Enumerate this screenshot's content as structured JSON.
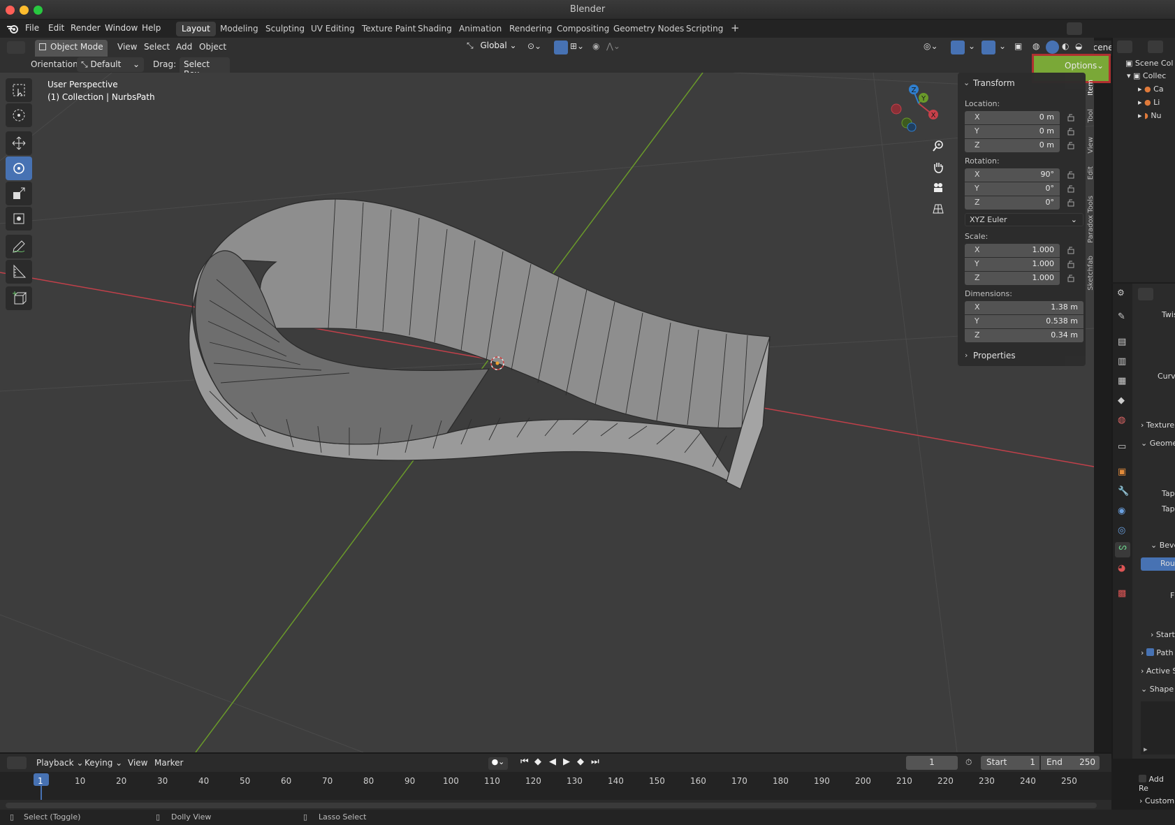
{
  "window": {
    "title": "Blender"
  },
  "menu": {
    "file": "File",
    "edit": "Edit",
    "render": "Render",
    "window": "Window",
    "help": "Help"
  },
  "workspaces": [
    "Layout",
    "Modeling",
    "Sculpting",
    "UV Editing",
    "Texture Paint",
    "Shading",
    "Animation",
    "Rendering",
    "Compositing",
    "Geometry Nodes",
    "Scripting"
  ],
  "active_workspace": "Layout",
  "add_workspace": "+",
  "scene": {
    "name": "Scene"
  },
  "header": {
    "mode": "Object Mode",
    "view": "View",
    "select": "Select",
    "add": "Add",
    "object": "Object",
    "transform_orientation": "Global",
    "orientation_label": "Orientation:",
    "orientation_value": "Default",
    "drag_label": "Drag:",
    "drag_value": "Select Box",
    "options": "Options"
  },
  "viewport": {
    "perspective": "User Perspective",
    "collection_info": "(1) Collection | NurbsPath",
    "gizmo_axes": {
      "x": "X",
      "y": "Y",
      "z": "Z"
    }
  },
  "npanel": {
    "tabs": [
      "Item",
      "Tool",
      "View",
      "Edit",
      "Paradox Tools",
      "Sketchfab"
    ],
    "transform_title": "Transform",
    "location_label": "Location:",
    "location": [
      {
        "axis": "X",
        "value": "0 m"
      },
      {
        "axis": "Y",
        "value": "0 m"
      },
      {
        "axis": "Z",
        "value": "0 m"
      }
    ],
    "rotation_label": "Rotation:",
    "rotation": [
      {
        "axis": "X",
        "value": "90°"
      },
      {
        "axis": "Y",
        "value": "0°"
      },
      {
        "axis": "Z",
        "value": "0°"
      }
    ],
    "rotation_mode": "XYZ Euler",
    "scale_label": "Scale:",
    "scale": [
      {
        "axis": "X",
        "value": "1.000"
      },
      {
        "axis": "Y",
        "value": "1.000"
      },
      {
        "axis": "Z",
        "value": "1.000"
      }
    ],
    "dimensions_label": "Dimensions:",
    "dimensions": [
      {
        "axis": "X",
        "value": "1.38 m"
      },
      {
        "axis": "Y",
        "value": "0.538 m"
      },
      {
        "axis": "Z",
        "value": "0.34 m"
      }
    ],
    "properties_title": "Properties"
  },
  "outliner": {
    "scene_collection": "Scene Col",
    "collection": "Collec",
    "items": [
      "Ca",
      "Li",
      "Nu"
    ]
  },
  "properties_editor": {
    "labels": [
      "Twis",
      "Curv",
      "Texture",
      "Geome",
      "Tap",
      "Tap",
      "Beve",
      "Rou",
      "F",
      "Start",
      "Path",
      "Active S",
      "Shape I",
      "Add Re",
      "Custom"
    ]
  },
  "timeline": {
    "playback": "Playback",
    "keying": "Keying",
    "view": "View",
    "marker": "Marker",
    "current_frame": "1",
    "start_label": "Start",
    "start": "1",
    "end_label": "End",
    "end": "250",
    "ruler_ticks": [
      "1",
      "10",
      "20",
      "30",
      "40",
      "50",
      "60",
      "70",
      "80",
      "90",
      "100",
      "110",
      "120",
      "130",
      "140",
      "150",
      "160",
      "170",
      "180",
      "190",
      "200",
      "210",
      "220",
      "230",
      "240",
      "250"
    ]
  },
  "status": {
    "select": "Select (Toggle)",
    "dolly": "Dolly View",
    "lasso": "Lasso Select"
  },
  "colors": {
    "accent": "#4772b3",
    "x_axis": "#c2404a",
    "y_axis": "#6a9a2a",
    "highlight_fill": "#7aa837",
    "highlight_border": "#b03030"
  }
}
